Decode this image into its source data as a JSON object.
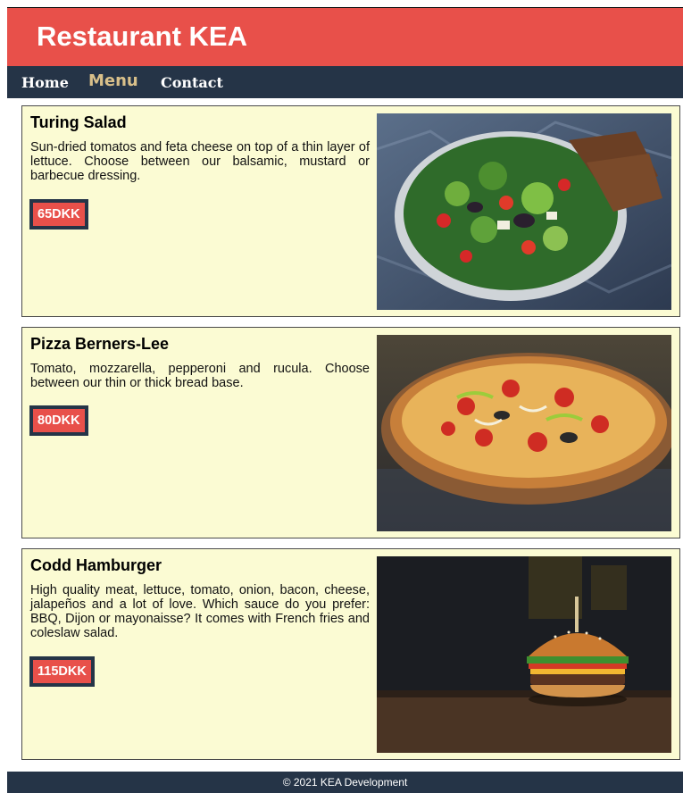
{
  "header": {
    "title": "Restaurant KEA"
  },
  "nav": {
    "items": [
      {
        "label": "Home"
      },
      {
        "label": "Menu"
      },
      {
        "label": "Contact"
      }
    ],
    "active": "Menu"
  },
  "menu": {
    "items": [
      {
        "title": "Turing Salad",
        "description": "Sun-dried tomatos and feta cheese on top of a thin layer of lettuce. Choose between our balsamic, mustard or barbecue dressing.",
        "price": "65DKK",
        "image_icon": "salad-photo"
      },
      {
        "title": "Pizza Berners-Lee",
        "description": "Tomato, mozzarella, pepperoni and rucula. Choose between our thin or thick bread base.",
        "price": "80DKK",
        "image_icon": "pizza-photo"
      },
      {
        "title": "Codd Hamburger",
        "description": "High quality meat, lettuce, tomato, onion, bacon, cheese, jalapeños and a lot of love. Which sauce do you prefer: BBQ, Dijon or mayonaisse? It comes with French fries and coleslaw salad.",
        "price": "115DKK",
        "image_icon": "burger-photo"
      }
    ]
  },
  "footer": {
    "text": "© 2021 KEA Development"
  },
  "colors": {
    "header_bg": "#e8504a",
    "nav_bg": "#253447",
    "nav_active": "#d9c08a",
    "card_bg": "#fbfbd3",
    "price_bg": "#e8504a"
  }
}
